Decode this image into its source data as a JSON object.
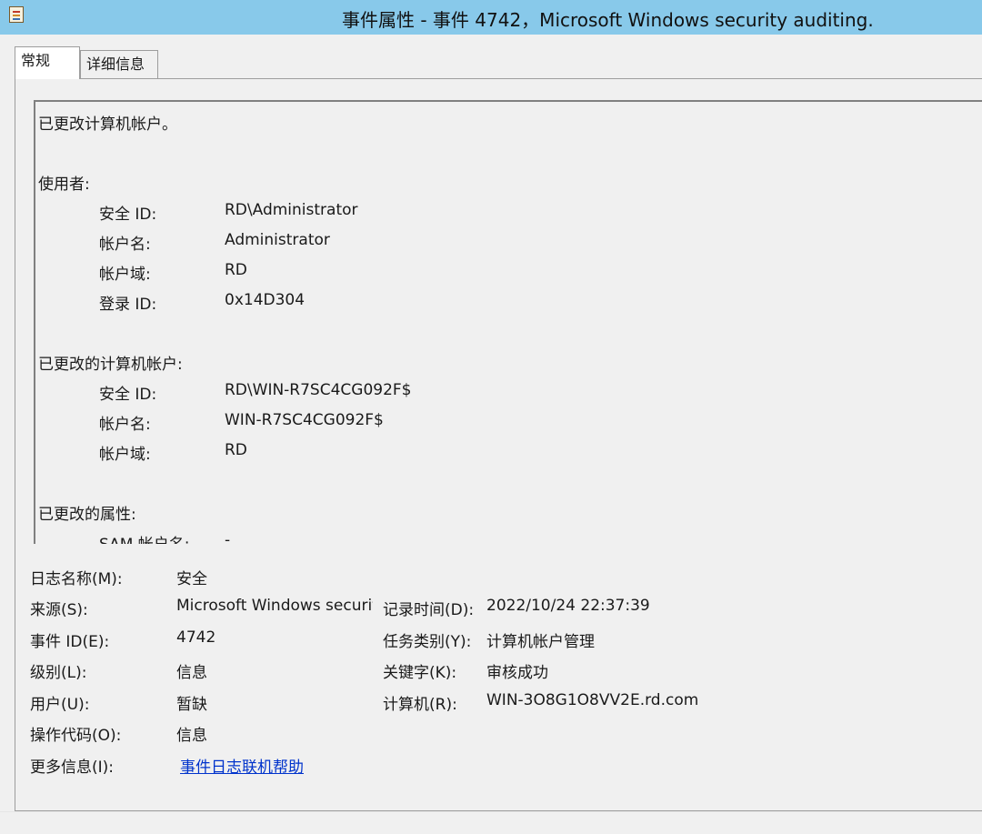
{
  "window": {
    "title": "事件属性 - 事件 4742，Microsoft Windows security auditing."
  },
  "tabs": [
    {
      "label": "常规",
      "selected": true
    },
    {
      "label": "详细信息",
      "selected": false
    }
  ],
  "description": {
    "heading": "已更改计算机帐户。",
    "subject_heading": "使用者:",
    "subject": [
      {
        "label": "安全 ID:",
        "value": "RD\\Administrator"
      },
      {
        "label": "帐户名:",
        "value": "Administrator"
      },
      {
        "label": "帐户域:",
        "value": "RD"
      },
      {
        "label": "登录 ID:",
        "value": "0x14D304"
      }
    ],
    "changed_account_heading": "已更改的计算机帐户:",
    "changed_account": [
      {
        "label": "安全 ID:",
        "value": "RD\\WIN-R7SC4CG092F$"
      },
      {
        "label": "帐户名:",
        "value": "WIN-R7SC4CG092F$"
      },
      {
        "label": "帐户域:",
        "value": "RD"
      }
    ],
    "changed_attributes_heading": "已更改的属性:",
    "changed_attributes_partial": {
      "label": "SAM 帐户名:",
      "value": "-"
    }
  },
  "details": {
    "log_name_label": "日志名称(M):",
    "log_name": "安全",
    "source_label": "来源(S):",
    "source": "Microsoft Windows security auditing.",
    "logged_label": "记录时间(D):",
    "logged": "2022/10/24 22:37:39",
    "event_id_label": "事件 ID(E):",
    "event_id": "4742",
    "task_category_label": "任务类别(Y):",
    "task_category": "计算机帐户管理",
    "level_label": "级别(L):",
    "level": "信息",
    "keywords_label": "关键字(K):",
    "keywords": "审核成功",
    "user_label": "用户(U):",
    "user": "暂缺",
    "computer_label": "计算机(R):",
    "computer": "WIN-3O8G1O8VV2E.rd.com",
    "opcode_label": "操作代码(O):",
    "opcode": "信息",
    "more_info_label": "更多信息(I):",
    "more_info_link": "事件日志联机帮助"
  }
}
